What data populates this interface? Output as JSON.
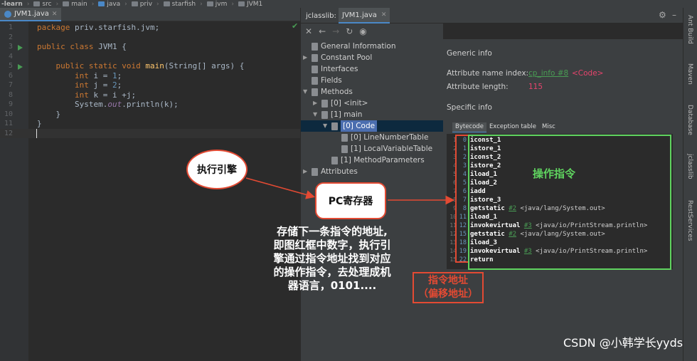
{
  "breadcrumb": [
    "-learn",
    "src",
    "main",
    "java",
    "priv",
    "starfish",
    "jvm",
    "JVM1"
  ],
  "editor": {
    "tab_label": "JVM1.java",
    "lines": [
      {
        "n": "1",
        "html": "<span class=\"kw\">package</span> priv.starfish.jvm;"
      },
      {
        "n": "2",
        "html": ""
      },
      {
        "n": "3",
        "html": "<span class=\"kw\">public class</span> JVM1 {"
      },
      {
        "n": "4",
        "html": ""
      },
      {
        "n": "5",
        "html": "    <span class=\"kw\">public static void</span> <span class=\"fn\">main</span>(String[] args) {"
      },
      {
        "n": "6",
        "html": "        <span class=\"kw\">int</span> i = <span class=\"nm\">1</span>;"
      },
      {
        "n": "7",
        "html": "        <span class=\"kw\">int</span> j = <span class=\"nm\">2</span>;"
      },
      {
        "n": "8",
        "html": "        <span class=\"kw\">int</span> k = i +j;"
      },
      {
        "n": "9",
        "html": "        System.<span class=\"it\">out</span>.println(k);"
      },
      {
        "n": "10",
        "html": "    }"
      },
      {
        "n": "11",
        "html": "}"
      },
      {
        "n": "12",
        "html": ""
      }
    ]
  },
  "jclasslib": {
    "tabs": [
      "jclasslib:",
      "JVM1.java"
    ],
    "tree": [
      {
        "label": "General Information",
        "depth": 0,
        "arrow": "",
        "icon": true
      },
      {
        "label": "Constant Pool",
        "depth": 0,
        "arrow": "▶",
        "icon": true
      },
      {
        "label": "Interfaces",
        "depth": 0,
        "arrow": "",
        "icon": true
      },
      {
        "label": "Fields",
        "depth": 0,
        "arrow": "",
        "icon": true
      },
      {
        "label": "Methods",
        "depth": 0,
        "arrow": "▼",
        "icon": true
      },
      {
        "label": "[0] <init>",
        "depth": 1,
        "arrow": "▶",
        "icon": true
      },
      {
        "label": "[1] main",
        "depth": 1,
        "arrow": "▼",
        "icon": true
      },
      {
        "label": "[0] Code",
        "depth": 2,
        "arrow": "▼",
        "icon": true,
        "selected": true
      },
      {
        "label": "[0] LineNumberTable",
        "depth": 3,
        "arrow": "",
        "icon": true
      },
      {
        "label": "[1] LocalVariableTable",
        "depth": 3,
        "arrow": "",
        "icon": true
      },
      {
        "label": "[1] MethodParameters",
        "depth": 2,
        "arrow": "",
        "icon": true
      },
      {
        "label": "Attributes",
        "depth": 0,
        "arrow": "▶",
        "icon": true
      }
    ],
    "generic_info": "Generic info",
    "attr_name_index_label": "Attribute name index:",
    "attr_name_index_link": "cp_info #8",
    "attr_name_index_value": "<Code>",
    "attr_length_label": "Attribute length:",
    "attr_length_value": "115",
    "specific_info": "Specific info",
    "subtabs": [
      "Bytecode",
      "Exception table",
      "Misc"
    ],
    "bytecode": [
      {
        "ln": "1",
        "off": "0",
        "ins": "iconst_1",
        "ref": "",
        "cmt": ""
      },
      {
        "ln": "2",
        "off": "1",
        "ins": "istore_1",
        "ref": "",
        "cmt": ""
      },
      {
        "ln": "3",
        "off": "2",
        "ins": "iconst_2",
        "ref": "",
        "cmt": ""
      },
      {
        "ln": "4",
        "off": "3",
        "ins": "istore_2",
        "ref": "",
        "cmt": ""
      },
      {
        "ln": "5",
        "off": "4",
        "ins": "iload_1",
        "ref": "",
        "cmt": ""
      },
      {
        "ln": "6",
        "off": "5",
        "ins": "iload_2",
        "ref": "",
        "cmt": ""
      },
      {
        "ln": "7",
        "off": "6",
        "ins": "iadd",
        "ref": "",
        "cmt": ""
      },
      {
        "ln": "8",
        "off": "7",
        "ins": "istore_3",
        "ref": "",
        "cmt": ""
      },
      {
        "ln": "9",
        "off": "8",
        "ins": "getstatic",
        "ref": "#2",
        "cmt": "<java/lang/System.out>"
      },
      {
        "ln": "10",
        "off": "11",
        "ins": "iload_1",
        "ref": "",
        "cmt": ""
      },
      {
        "ln": "11",
        "off": "12",
        "ins": "invokevirtual",
        "ref": "#3",
        "cmt": "<java/io/PrintStream.println>"
      },
      {
        "ln": "12",
        "off": "15",
        "ins": "getstatic",
        "ref": "#2",
        "cmt": "<java/lang/System.out>"
      },
      {
        "ln": "13",
        "off": "18",
        "ins": "iload_3",
        "ref": "",
        "cmt": ""
      },
      {
        "ln": "14",
        "off": "19",
        "ins": "invokevirtual",
        "ref": "#3",
        "cmt": "<java/io/PrintStream.println>"
      },
      {
        "ln": "15",
        "off": "22",
        "ins": "return",
        "ref": "",
        "cmt": ""
      }
    ]
  },
  "right_sidebar": [
    "Ant Build",
    "Maven",
    "Database",
    "jclasslib",
    "RestServices"
  ],
  "annotations": {
    "engine": "执行引擎",
    "pc_register": "PC寄存器",
    "explanation": [
      "存储下一条指令的地址,",
      "即图红框中数字，执行引",
      "擎通过指令地址找到对应",
      "的操作指令，去处理成机",
      "器语言，0101...."
    ],
    "instruction_address": [
      "指令地址",
      "（偏移地址）"
    ],
    "opcode": "操作指令",
    "watermark": "CSDN @小韩学长yyds"
  },
  "colors": {
    "annotation_red": "#e34a33",
    "annotation_green": "#5fd35f",
    "editor_bg": "#2b2b2b",
    "panel_bg": "#3c3f41"
  }
}
